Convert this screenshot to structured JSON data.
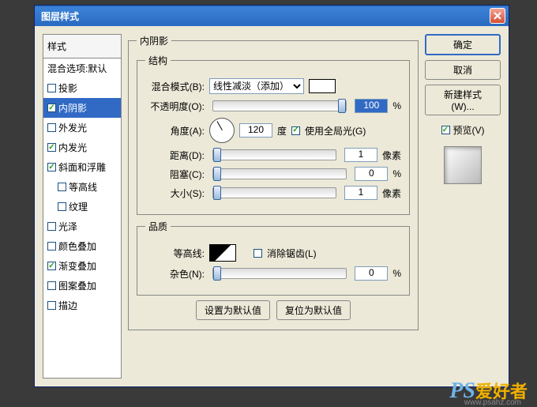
{
  "title": "图层样式",
  "styles": {
    "header": "样式",
    "items": [
      {
        "label": "混合选项:默认",
        "checked": null
      },
      {
        "label": "投影",
        "checked": false
      },
      {
        "label": "内阴影",
        "checked": true,
        "selected": true
      },
      {
        "label": "外发光",
        "checked": false
      },
      {
        "label": "内发光",
        "checked": true
      },
      {
        "label": "斜面和浮雕",
        "checked": true
      },
      {
        "label": "等高线",
        "checked": false,
        "indent": true
      },
      {
        "label": "纹理",
        "checked": false,
        "indent": true
      },
      {
        "label": "光泽",
        "checked": false
      },
      {
        "label": "颜色叠加",
        "checked": false
      },
      {
        "label": "渐变叠加",
        "checked": true
      },
      {
        "label": "图案叠加",
        "checked": false
      },
      {
        "label": "描边",
        "checked": false
      }
    ]
  },
  "panel": {
    "title": "内阴影",
    "structure": {
      "legend": "结构",
      "blendmode_label": "混合模式(B):",
      "blendmode_value": "线性减淡（添加）",
      "opacity_label": "不透明度(O):",
      "opacity_value": "100",
      "opacity_unit": "%",
      "angle_label": "角度(A):",
      "angle_value": "120",
      "angle_unit": "度",
      "global_label": "使用全局光(G)",
      "distance_label": "距离(D):",
      "distance_value": "1",
      "distance_unit": "像素",
      "choke_label": "阻塞(C):",
      "choke_value": "0",
      "choke_unit": "%",
      "size_label": "大小(S):",
      "size_value": "1",
      "size_unit": "像素"
    },
    "quality": {
      "legend": "品质",
      "contour_label": "等高线:",
      "antialias_label": "消除锯齿(L)",
      "noise_label": "杂色(N):",
      "noise_value": "0",
      "noise_unit": "%"
    },
    "defaults": {
      "set": "设置为默认值",
      "reset": "复位为默认值"
    }
  },
  "buttons": {
    "ok": "确定",
    "cancel": "取消",
    "newstyle": "新建样式(W)...",
    "preview": "预览(V)"
  },
  "watermark": {
    "ps": "PS",
    "txt": "爱好者",
    "url": "www.psahz.com"
  }
}
